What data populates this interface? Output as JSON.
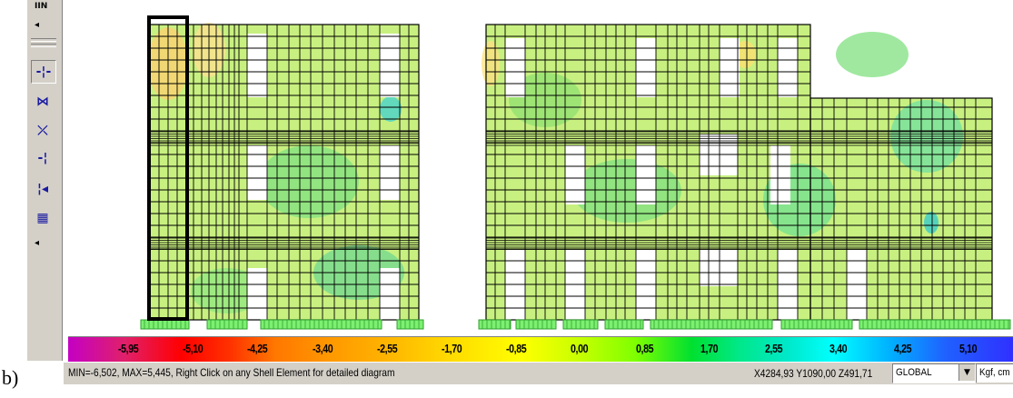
{
  "toolbar": {
    "top_label": "IIN",
    "buttons": [
      {
        "icon": "fit-both-ends-icon",
        "glyph": "-|-"
      },
      {
        "icon": "fit-start-icon",
        "glyph": "X"
      },
      {
        "icon": "cross-icon",
        "glyph": "×"
      },
      {
        "icon": "joint-left-icon",
        "glyph": "+"
      },
      {
        "icon": "joint-right-icon",
        "glyph": "|"
      },
      {
        "icon": "grid-mesh-icon",
        "glyph": "▦"
      }
    ]
  },
  "scale": {
    "ticks": [
      "-5,95",
      "-5,10",
      "-4,25",
      "-3,40",
      "-2,55",
      "-1,70",
      "-0,85",
      "0,00",
      "0,85",
      "1,70",
      "2,55",
      "3,40",
      "4,25",
      "5,10"
    ]
  },
  "status": {
    "message": "MIN=-6,502, MAX=5,445, Right Click on any Shell Element for detailed diagram",
    "coords": "X4284,93 Y1090,00 Z491,71",
    "coord_system": "GLOBAL",
    "units": "Kgf, cm"
  },
  "caption": "b)",
  "colors": {
    "mesh_base": "#c8f080",
    "mesh_line": "#000000",
    "toolbar_bg": "#d4d0c8"
  }
}
